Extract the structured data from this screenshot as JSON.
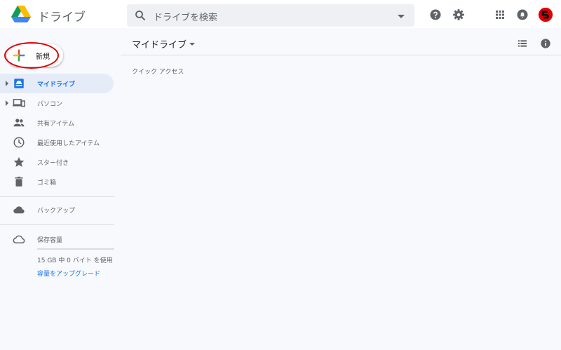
{
  "header": {
    "app_title": "ドライブ",
    "search_placeholder": "ドライブを検索",
    "icons": [
      "search-icon",
      "help-icon",
      "settings-icon",
      "apps-icon",
      "notifications-icon",
      "account-avatar"
    ]
  },
  "sidebar": {
    "new_label": "新規",
    "items": [
      {
        "label": "マイドライブ",
        "icon": "my-drive-icon",
        "active": true,
        "expandable": true
      },
      {
        "label": "パソコン",
        "icon": "computers-icon",
        "active": false,
        "expandable": true
      },
      {
        "label": "共有アイテム",
        "icon": "shared-icon",
        "active": false,
        "expandable": false
      },
      {
        "label": "最近使用したアイテム",
        "icon": "recent-icon",
        "active": false,
        "expandable": false
      },
      {
        "label": "スター付き",
        "icon": "star-icon",
        "active": false,
        "expandable": false
      },
      {
        "label": "ゴミ箱",
        "icon": "trash-icon",
        "active": false,
        "expandable": false
      },
      {
        "label": "バックアップ",
        "icon": "backup-icon",
        "active": false,
        "expandable": false
      },
      {
        "label": "保存容量",
        "icon": "storage-icon",
        "active": false,
        "expandable": false
      }
    ],
    "storage_text": "15 GB 中 0 バイト を使用",
    "upgrade_label": "容量をアップグレード"
  },
  "main": {
    "title": "マイドライブ",
    "quick_access": "クイック アクセス"
  },
  "colors": {
    "accent": "#1a73e8",
    "active_bg": "#e5ecf8",
    "annotation_circle": "#e00000"
  }
}
